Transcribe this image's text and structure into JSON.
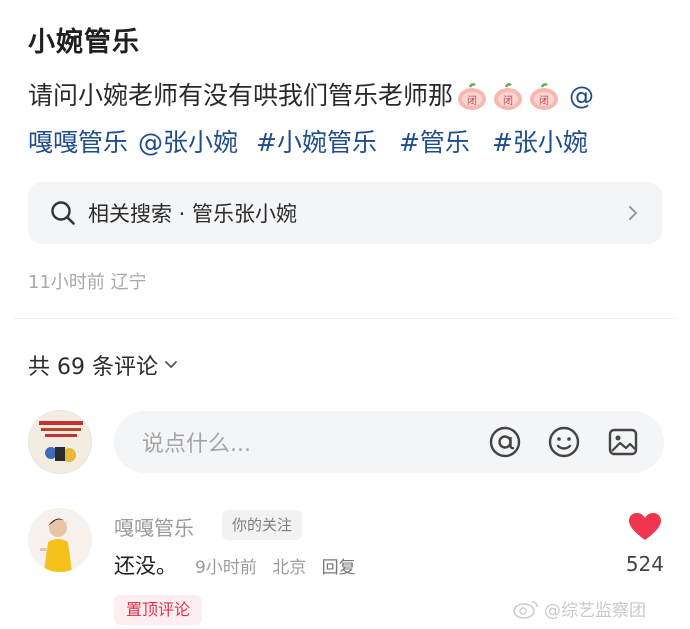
{
  "post": {
    "title": "小婉管乐",
    "body_text": "请问小婉老师有没有哄我们管乐老师那",
    "body_emoji": "peach-emoji",
    "at_symbol": "@",
    "mention_1": "嘎嘎管乐",
    "mention_2": "@张小婉",
    "tags": [
      "#小婉管乐",
      "#管乐",
      "#张小婉"
    ]
  },
  "related_search": {
    "label": "相关搜索 · 管乐张小婉",
    "icon": "search-icon"
  },
  "meta": {
    "time": "11小时前",
    "location": "辽宁"
  },
  "comments": {
    "count_label": "共 69 条评论",
    "input_placeholder": "说点什么...",
    "input_icons": [
      "at-icon",
      "emoji-icon",
      "image-icon"
    ]
  },
  "comment": {
    "author": "嘎嘎管乐",
    "badge": "你的关注",
    "text": "还没。",
    "time": "9小时前",
    "location": "北京",
    "reply_label": "回复",
    "likes": "524",
    "pinned_label": "置顶评论"
  },
  "watermark": "@综艺监察团",
  "colors": {
    "link": "#1f4d8c",
    "like": "#f0364f",
    "pinned": "#e0324c"
  }
}
